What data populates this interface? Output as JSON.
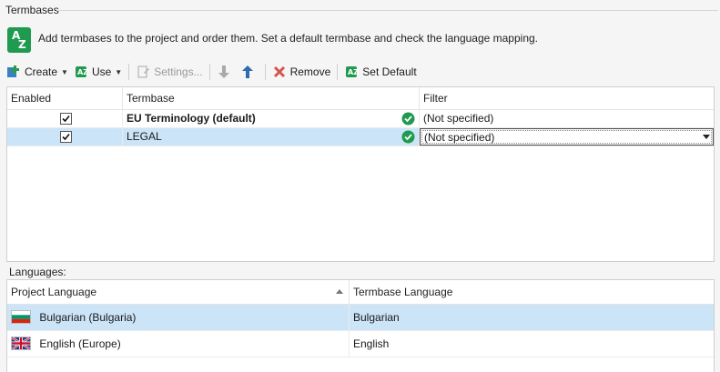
{
  "section": {
    "title": "Termbases"
  },
  "header": {
    "description": "Add termbases to the project and order them. Set a default termbase and check the language mapping."
  },
  "toolbar": {
    "create_label": "Create",
    "use_label": "Use",
    "settings_label": "Settings...",
    "remove_label": "Remove",
    "set_default_label": "Set Default"
  },
  "termbase_grid": {
    "columns": {
      "enabled": "Enabled",
      "termbase": "Termbase",
      "filter": "Filter"
    },
    "rows": [
      {
        "enabled": true,
        "name": "EU Terminology (default)",
        "filter": "(Not specified)",
        "selected": false
      },
      {
        "enabled": true,
        "name": "LEGAL",
        "filter": "(Not specified)",
        "selected": true
      }
    ]
  },
  "languages": {
    "label": "Languages:",
    "columns": {
      "project_language": "Project Language",
      "termbase_language": "Termbase Language"
    },
    "rows": [
      {
        "project": "Bulgarian (Bulgaria)",
        "termbase": "Bulgarian",
        "flag": "bulgaria-flag-icon",
        "selected": true
      },
      {
        "project": "English (Europe)",
        "termbase": "English",
        "flag": "eu-flag-icon",
        "selected": false
      }
    ]
  },
  "colors": {
    "accent_green": "#1f9a4f",
    "selection": "#cce4f7",
    "remove_red": "#d9534f",
    "arrow_blue": "#2e6bb0"
  }
}
